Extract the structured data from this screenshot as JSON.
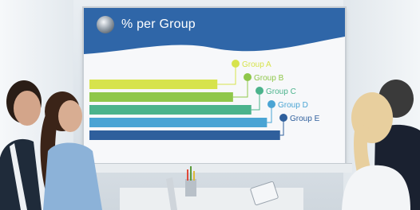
{
  "slide": {
    "title": "% per Group",
    "logo_icon": "orb-icon"
  },
  "chart_data": {
    "type": "bar",
    "orientation": "horizontal",
    "categories": [
      "Group A",
      "Group B",
      "Group C",
      "Group D",
      "Group E"
    ],
    "values": [
      49,
      55,
      62,
      68,
      73
    ],
    "colors": [
      "#d7e34c",
      "#8fc74a",
      "#4bb38c",
      "#4aa4d4",
      "#2f5f9c"
    ],
    "xlim": [
      0,
      100
    ],
    "grid": false,
    "legend": "callouts"
  }
}
